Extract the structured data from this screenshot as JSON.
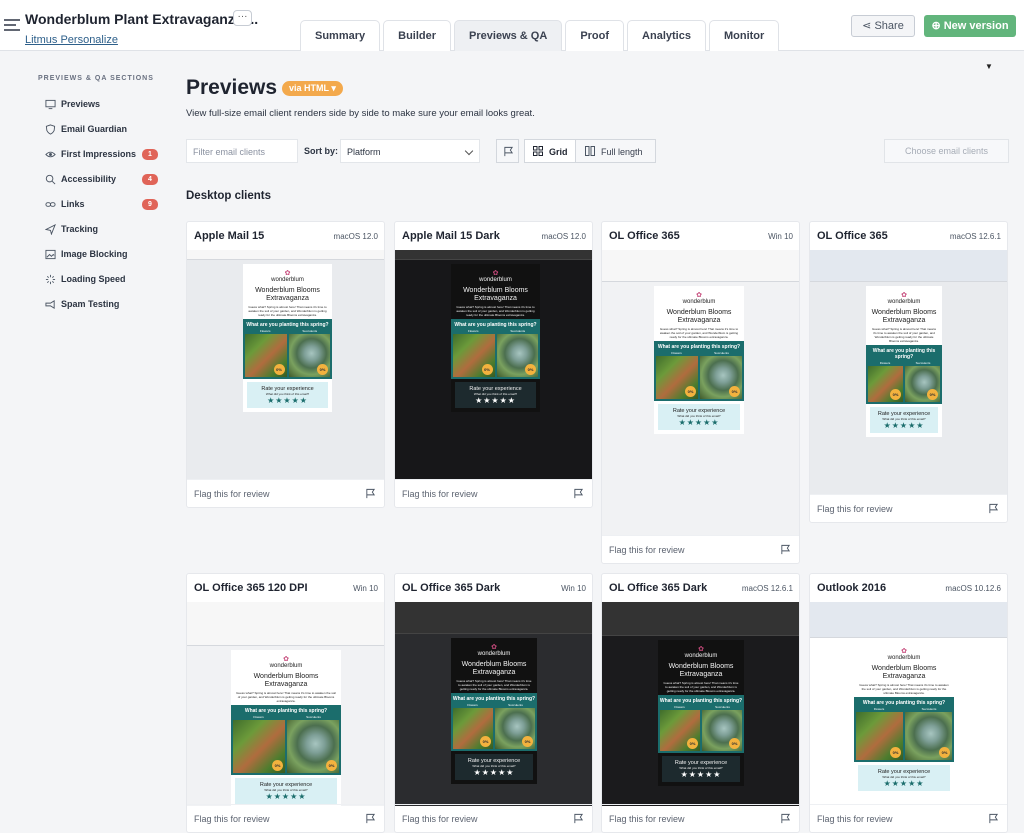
{
  "header": {
    "project_title": "Wonderblum Plant Extravaganza ...",
    "project_subtitle": "Litmus Personalize",
    "more_label": "···",
    "tabs": [
      {
        "label": "Summary",
        "active": false
      },
      {
        "label": "Builder",
        "active": false
      },
      {
        "label": "Previews & QA",
        "active": true
      },
      {
        "label": "Proof",
        "active": false
      },
      {
        "label": "Analytics",
        "active": false
      },
      {
        "label": "Monitor",
        "active": false
      }
    ],
    "share_label": "Share",
    "new_version_label": "New version",
    "accent_color": "#62b57c"
  },
  "sidebar": {
    "heading": "PREVIEWS & QA SECTIONS",
    "items": [
      {
        "label": "Previews",
        "icon": "monitor-icon"
      },
      {
        "label": "Email Guardian",
        "icon": "shield-icon"
      },
      {
        "label": "First Impressions",
        "icon": "eye-icon",
        "badge": "1"
      },
      {
        "label": "Accessibility",
        "icon": "magnifier-icon",
        "badge": "4"
      },
      {
        "label": "Links",
        "icon": "link-icon",
        "badge": "9"
      },
      {
        "label": "Tracking",
        "icon": "send-icon"
      },
      {
        "label": "Image Blocking",
        "icon": "image-icon"
      },
      {
        "label": "Loading Speed",
        "icon": "spinner-icon"
      },
      {
        "label": "Spam Testing",
        "icon": "megaphone-icon"
      }
    ]
  },
  "main": {
    "title": "Previews",
    "via_label": "via HTML",
    "intro": "View full-size email client renders side by side to make sure your email looks great.",
    "filter_placeholder": "Filter email clients",
    "sort_label": "Sort by:",
    "sort_value": "Platform",
    "grid_label": "Grid",
    "full_length_label": "Full length",
    "choose_label": "Choose email clients",
    "section_title": "Desktop clients",
    "flag_label": "Flag this for review"
  },
  "email": {
    "brand": "wonderblum",
    "headline_1": "Wonderblum Blooms",
    "headline_2": "Extravaganza",
    "body": "Guess what? Spring is almost here! That means it's time to awaken the soil of your garden, and Wonderblum is getting ready for the ultimate Blooms extravaganza.",
    "question": "What are you planting this spring?",
    "col1": "Flowers",
    "col2": "Succulents",
    "pct": "0%",
    "rate_title": "Rate your experience",
    "rate_sub": "What did you think of this email?",
    "stars": "★★★★★"
  },
  "clients": [
    {
      "name": "Apple Mail 15",
      "os": "macOS 12.0",
      "theme": "light"
    },
    {
      "name": "Apple Mail 15 Dark",
      "os": "macOS 12.0",
      "theme": "dark"
    },
    {
      "name": "OL Office 365",
      "os": "Win 10",
      "theme": "light"
    },
    {
      "name": "OL Office 365",
      "os": "macOS 12.6.1",
      "theme": "light"
    },
    {
      "name": "OL Office 365 120 DPI",
      "os": "Win 10",
      "theme": "light"
    },
    {
      "name": "OL Office 365 Dark",
      "os": "Win 10",
      "theme": "dark"
    },
    {
      "name": "OL Office 365 Dark",
      "os": "macOS 12.6.1",
      "theme": "dark"
    },
    {
      "name": "Outlook 2016",
      "os": "macOS 10.12.6",
      "theme": "light"
    }
  ]
}
